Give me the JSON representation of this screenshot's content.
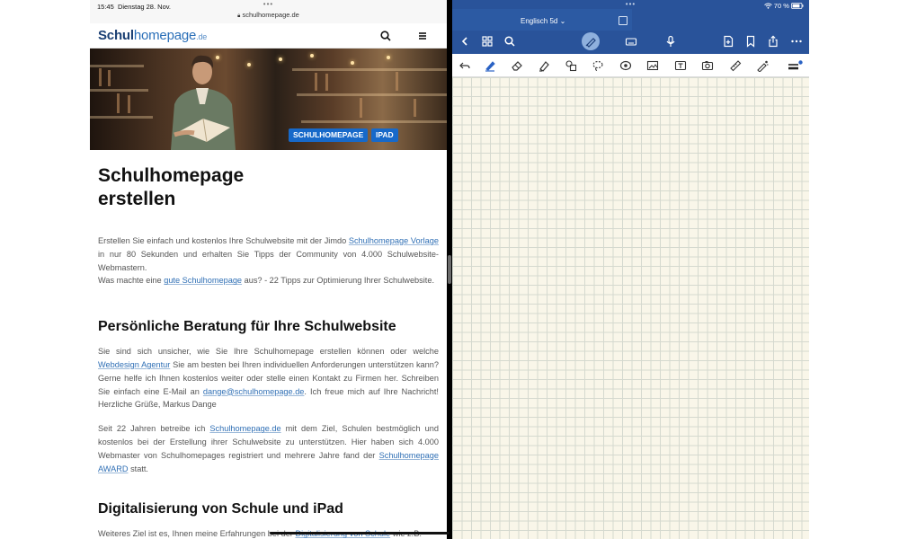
{
  "status": {
    "time": "15:45",
    "date": "Dienstag 28. Nov.",
    "battery": "70 %"
  },
  "safari": {
    "url": "schulhomepage.de",
    "logo": {
      "bold": "Schul",
      "rest": "homepage",
      "tld": ".de"
    },
    "hero_tags": [
      "SCHULHOMEPAGE",
      "IPAD"
    ],
    "title": "Schulhomepage\nerstellen",
    "intro": {
      "t1": "Erstellen Sie einfach und kostenlos Ihre Schulwebsite mit der Jimdo ",
      "link1": "Schulhomepage Vorlage",
      "t2": " in nur 80 Sekunden und erhalten Sie Tipps der Community von 4.000 Schulwebsite-Webmastern.",
      "t3": "Was machte eine ",
      "link2": "gute Schulhomepage",
      "t4": " aus? - 22 Tipps zur Optimierung Ihrer Schulwebsite."
    },
    "section1": {
      "heading": "Persönliche Beratung für Ihre Schulwebsite",
      "p1_t1": "Sie sind sich unsicher, wie Sie Ihre Schulhomepage erstellen können oder welche ",
      "p1_link1": "Webdesign Agentur",
      "p1_t2": " Sie am besten bei Ihren individuellen Anforderungen unterstützen kann? Gerne helfe ich Ihnen kostenlos weiter oder stelle einen Kontakt zu Firmen her. Schreiben Sie einfach eine E-Mail an ",
      "p1_link2": "dange@schulhomepage.de",
      "p1_t3": ". Ich freue mich auf Ihre Nachricht! Herzliche Grüße, Markus Dange",
      "p2_t1": "Seit 22 Jahren betreibe ich ",
      "p2_link1": "Schulhomepage.de",
      "p2_t2": " mit dem Ziel, Schulen bestmöglich und kostenlos bei der Erstellung ihrer Schulwebsite zu unterstützen. Hier haben sich 4.000 Webmaster von Schulhomepages registriert und mehrere Jahre fand der ",
      "p2_link2": "Schulhomepage AWARD",
      "p2_t3": " statt."
    },
    "section2": {
      "heading": "Digitalisierung von Schule und iPad",
      "p_t1": "Weiteres Ziel ist es, Ihnen meine Erfahrungen bei der ",
      "p_link1": "Digitalisierung von Schule",
      "p_t2": " wie z.B."
    }
  },
  "goodnotes": {
    "notebook_title": "Englisch 5d",
    "header_icons": [
      "back-chevron-icon",
      "grid-icon",
      "search-icon",
      "pen-mode-icon",
      "keyboard-icon",
      "microphone-icon",
      "add-page-icon",
      "bookmark-icon",
      "share-icon",
      "more-icon"
    ],
    "tools": [
      "undo-icon",
      "pen-icon",
      "eraser-icon",
      "highlighter-icon",
      "shapes-icon",
      "lasso-icon",
      "elements-icon",
      "image-icon",
      "textbox-icon",
      "camera-icon",
      "ruler-icon",
      "laser-pointer-icon",
      "line-width-icon"
    ],
    "colors": {
      "header_bg": "#29539a",
      "paper_bg": "#f9f6e9",
      "grid_line": "#d5d9cf",
      "active_tool": "#2a62c4"
    }
  }
}
